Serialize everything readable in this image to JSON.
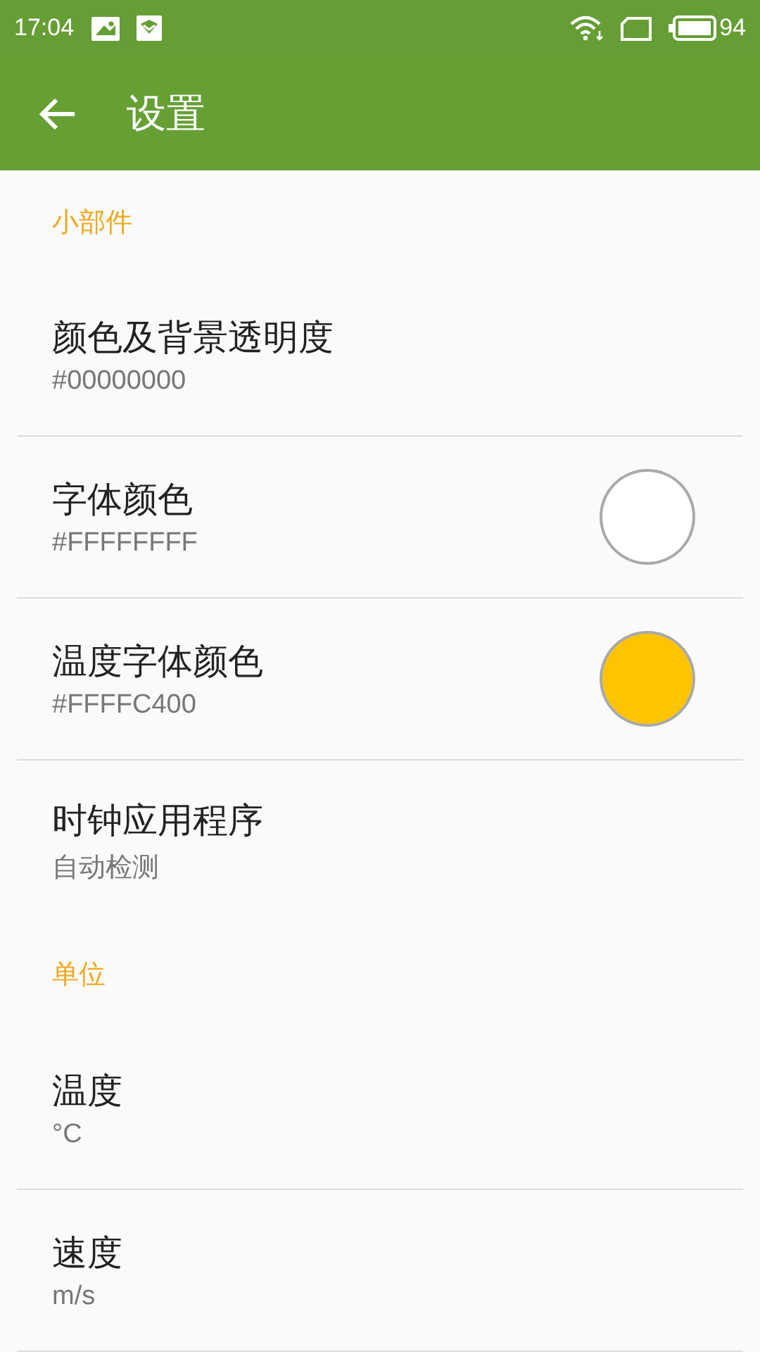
{
  "status_bar": {
    "time": "17:04",
    "battery": "94"
  },
  "app_bar": {
    "title": "设置"
  },
  "sections": [
    {
      "header": "小部件",
      "rows": [
        {
          "kind": "plain",
          "title": "颜色及背景透明度",
          "subtitle": "#00000000"
        },
        {
          "kind": "color",
          "title": "字体颜色",
          "subtitle": "#FFFFFFFF",
          "color": "#ffffff"
        },
        {
          "kind": "color",
          "title": "温度字体颜色",
          "subtitle": "#FFFFC400",
          "color": "#ffc400"
        },
        {
          "kind": "plain",
          "title": "时钟应用程序",
          "subtitle": "自动检测"
        }
      ]
    },
    {
      "header": "单位",
      "rows": [
        {
          "kind": "plain",
          "title": "温度",
          "subtitle": "°C"
        },
        {
          "kind": "plain",
          "title": "速度",
          "subtitle": "m/s"
        }
      ]
    }
  ]
}
